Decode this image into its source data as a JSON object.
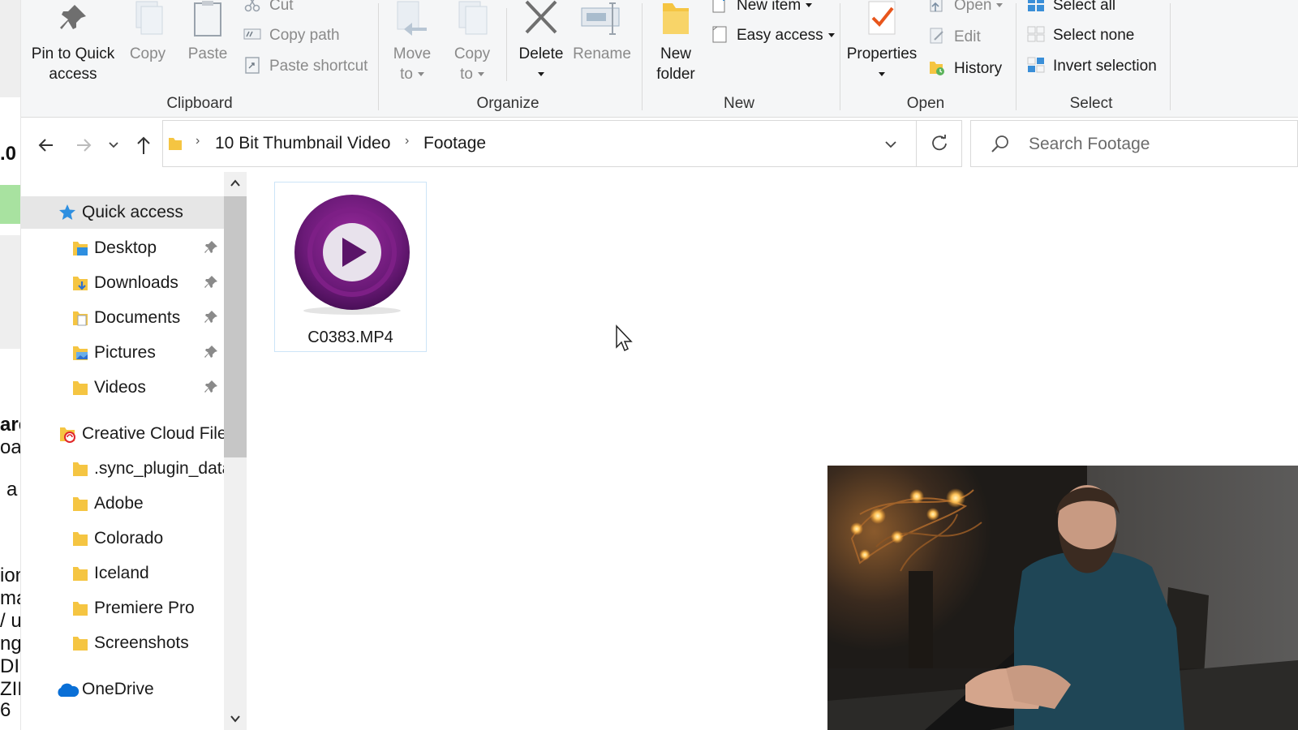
{
  "background_window": {
    "fragments": [
      ".0",
      "are",
      "oar",
      "a",
      "ion",
      "ma",
      "/ u",
      "ng",
      "DI",
      "ZIP",
      "6"
    ]
  },
  "ribbon": {
    "clipboard": {
      "group_label": "Clipboard",
      "pin_line1": "Pin to Quick",
      "pin_line2": "access",
      "copy": "Copy",
      "paste": "Paste",
      "cut": "Cut",
      "copy_path": "Copy path",
      "paste_shortcut": "Paste shortcut"
    },
    "organize": {
      "group_label": "Organize",
      "move_line1": "Move",
      "move_line2": "to",
      "copy_line1": "Copy",
      "copy_line2": "to",
      "delete": "Delete",
      "rename": "Rename"
    },
    "new": {
      "group_label": "New",
      "new_folder_line1": "New",
      "new_folder_line2": "folder",
      "new_item": "New item",
      "easy_access": "Easy access"
    },
    "open": {
      "group_label": "Open",
      "properties": "Properties",
      "open": "Open",
      "edit": "Edit",
      "history": "History"
    },
    "select": {
      "group_label": "Select",
      "select_all": "Select all",
      "select_none": "Select none",
      "invert_selection": "Invert selection"
    }
  },
  "address": {
    "crumbs": [
      "10 Bit Thumbnail Video",
      "Footage"
    ],
    "search_placeholder": "Search Footage"
  },
  "nav_pane": {
    "quick_access": "Quick access",
    "pinned": [
      "Desktop",
      "Downloads",
      "Documents",
      "Pictures",
      "Videos"
    ],
    "creative_cloud": "Creative Cloud Files",
    "cc_children": [
      ".sync_plugin_data",
      "Adobe",
      "Colorado",
      "Iceland",
      "Premiere Pro",
      "Screenshots"
    ],
    "onedrive": "OneDrive"
  },
  "files": [
    {
      "name": "C0383.MP4"
    }
  ],
  "colors": {
    "accent": "#0078d4",
    "folder": "#f5c542",
    "media_purple": "#6b1a78",
    "delete_gray": "#6f6f6f",
    "properties_check": "#e8561c"
  }
}
